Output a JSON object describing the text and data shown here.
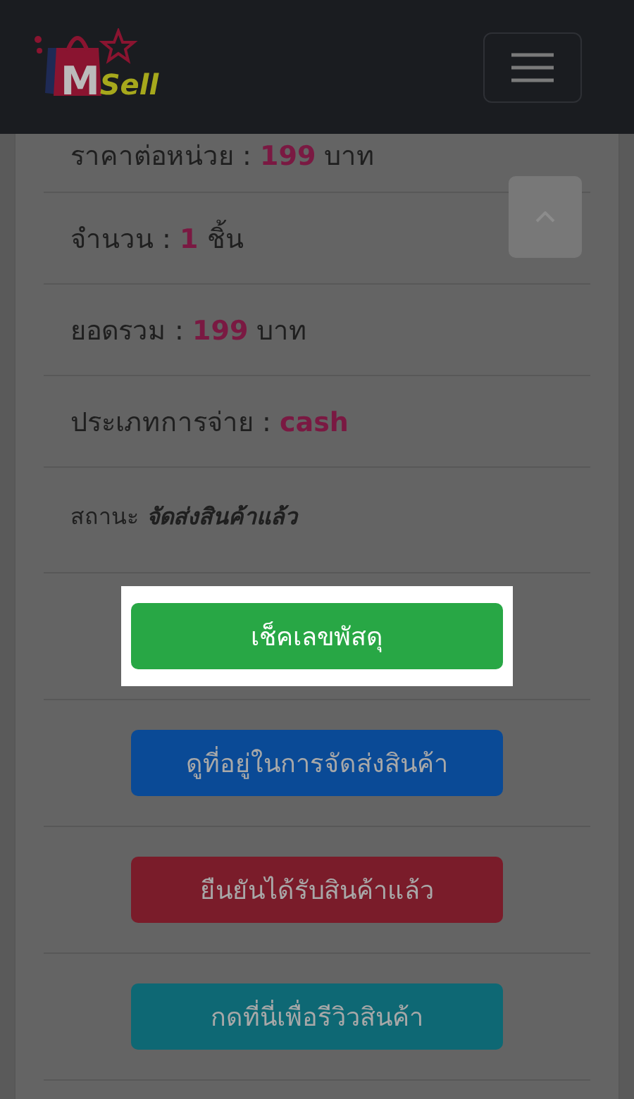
{
  "header": {
    "logo": {
      "letter": "M",
      "word": "Sell"
    }
  },
  "details": [
    {
      "kind": "amount",
      "label": "ราคาต่อหน่วย :",
      "value": "199",
      "unit": "บาท"
    },
    {
      "kind": "amount",
      "label": "จำนวน :",
      "value": "1",
      "unit": "ชิ้น"
    },
    {
      "kind": "amount",
      "label": "ยอดรวม :",
      "value": "199",
      "unit": "บาท"
    },
    {
      "kind": "amount",
      "label": "ประเภทการจ่าย :",
      "value": "cash"
    },
    {
      "kind": "status",
      "label": "สถานะ",
      "value": "จัดส่งสินค้าแล้ว"
    }
  ],
  "actions": [
    {
      "label": "เช็คเลขพัสดุ",
      "color": "#28a745",
      "highlighted": true
    },
    {
      "label": "ดูที่อยู่ในการจัดส่งสินค้า",
      "color": "#0a4a96",
      "highlighted": false
    },
    {
      "label": "ยืนยันได้รับสินค้าแล้ว",
      "color": "#7a1c2a",
      "highlighted": false
    },
    {
      "label": "กดที่นี่เพื่อรีวิวสินค้า",
      "color": "#0e6874",
      "highlighted": false
    }
  ]
}
